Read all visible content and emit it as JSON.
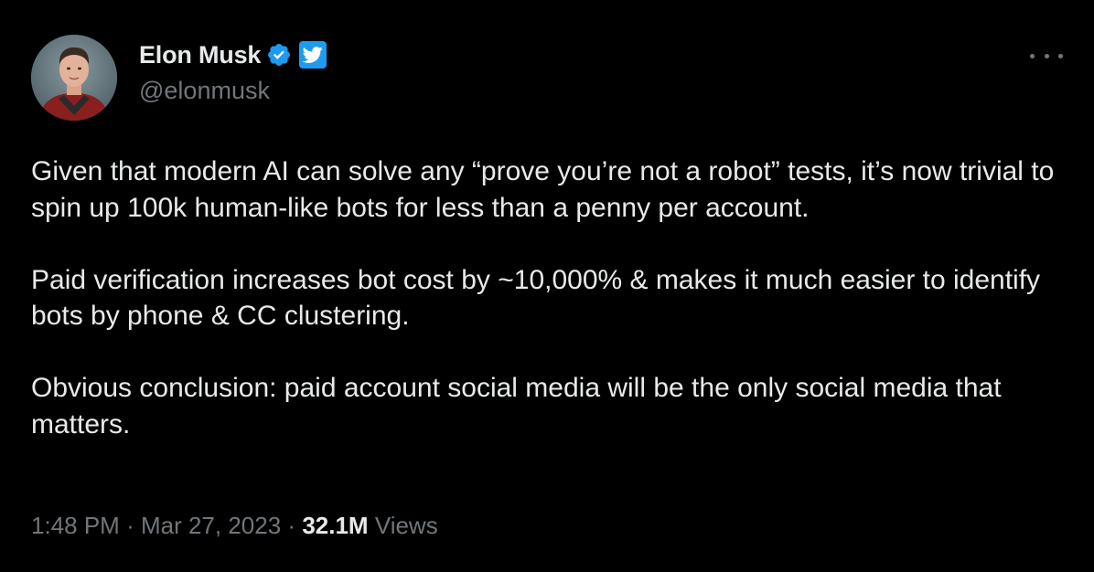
{
  "author": {
    "display_name": "Elon Musk",
    "handle": "@elonmusk"
  },
  "tweet": {
    "paragraphs": [
      "Given that modern AI can solve any “prove you’re not a robot” tests, it’s now trivial to spin up 100k human-like bots for less than a penny per account.",
      "Paid verification increases bot cost by ~10,000% & makes it much easier to identify bots by phone & CC clustering.",
      "Obvious conclusion: paid account social media will be the only social media that matters."
    ]
  },
  "meta": {
    "time": "1:48 PM",
    "separator": "·",
    "date": "Mar 27, 2023",
    "views_count": "32.1M",
    "views_label": "Views"
  },
  "icons": {
    "verified": "verified-badge-icon",
    "platform": "twitter-bird-icon",
    "more": "more-options-icon"
  },
  "colors": {
    "background": "#000000",
    "text_primary": "#e7e9ea",
    "text_secondary": "#71767b",
    "accent": "#1d9bf0"
  }
}
